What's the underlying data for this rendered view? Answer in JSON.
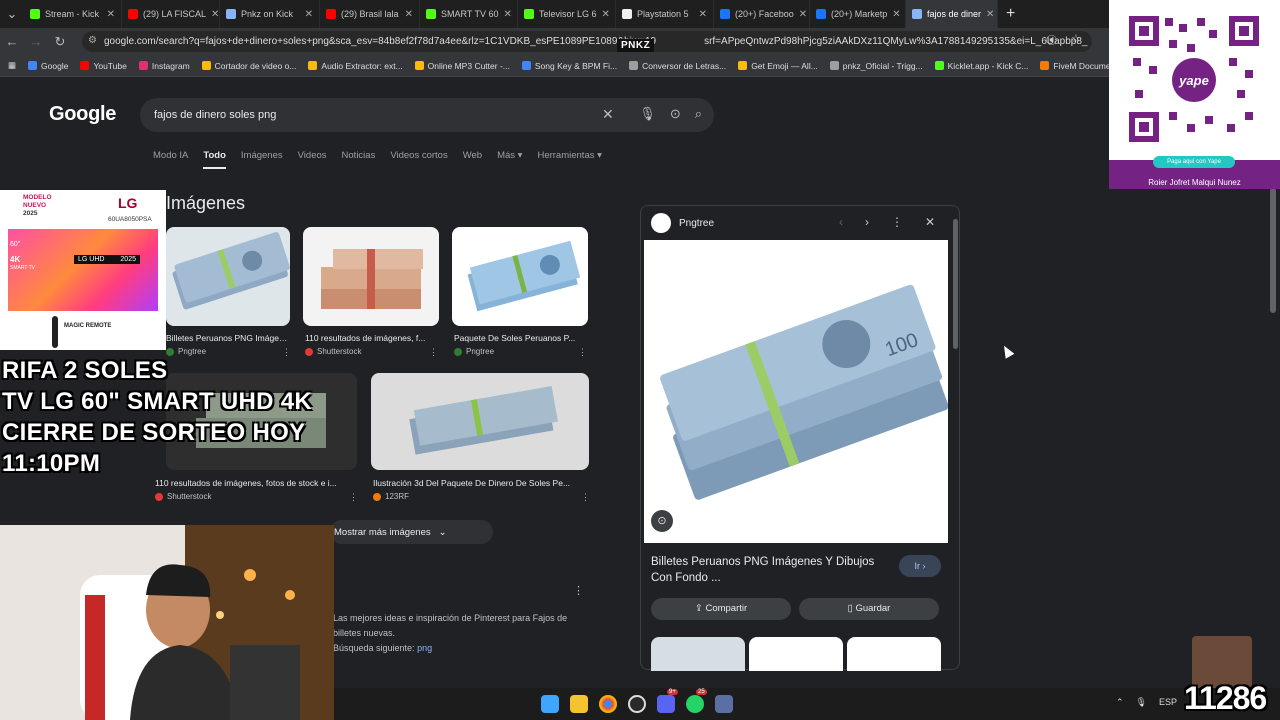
{
  "tabs": [
    {
      "label": "Stream - Kick",
      "color": "#53fc18"
    },
    {
      "label": "(29) LA FISCAL",
      "color": "#ff0000"
    },
    {
      "label": "Pnkz on Kick",
      "color": "#8ab4f8"
    },
    {
      "label": "(29) Brasil lala",
      "color": "#ff0000"
    },
    {
      "label": "SMART TV 60",
      "color": "#53fc18"
    },
    {
      "label": "Televisor LG 6",
      "color": "#53fc18"
    },
    {
      "label": "Playstation 5",
      "color": "#eeeeee"
    },
    {
      "label": "(20+) Faceboo",
      "color": "#1877f2"
    },
    {
      "label": "(20+) Marketp",
      "color": "#1877f2"
    },
    {
      "label": "fajos de diner",
      "color": "#8ab4f8",
      "active": true
    }
  ],
  "new_tab": "+",
  "tab_close": "✕",
  "address": "google.com/search?q=fajos+de+dinero+soles+png&sca_esv=84b8ef2f78d7a4ee&rlz=1C1VDKB_esPE1089PE1089&biw=19",
  "address_tail": "srf=APpeQntwzPd98hPjcg5ziAAkDXz11QMyLw%3A1788149295135&ei=L_6Uapbp8_",
  "overlay_tag": "PNKZ",
  "bookmarks": [
    {
      "label": "Google",
      "color": "#4285f4"
    },
    {
      "label": "YouTube",
      "color": "#ff0000"
    },
    {
      "label": "Instagram",
      "color": "#e1306c"
    },
    {
      "label": "Cortador de video o...",
      "color": "#fbbc05"
    },
    {
      "label": "Audio Extractor: ext...",
      "color": "#fbbc05"
    },
    {
      "label": "Online MP3 Cutter -...",
      "color": "#fbbc05"
    },
    {
      "label": "Song Key & BPM Fi...",
      "color": "#4285f4"
    },
    {
      "label": "Conversor de Letras...",
      "color": "#9e9e9e"
    },
    {
      "label": "Get Emoji — All...",
      "color": "#fbbc05"
    },
    {
      "label": "pnkz_Oficial - Trigg...",
      "color": "#9e9e9e"
    },
    {
      "label": "Kicklet.app - Kick C...",
      "color": "#53fc18"
    },
    {
      "label": "FiveM Documentat",
      "color": "#f57c00"
    }
  ],
  "google": {
    "logo": "Google",
    "query": "fajos de dinero soles png",
    "filters": [
      "Modo IA",
      "Todo",
      "Imágenes",
      "Videos",
      "Noticias",
      "Videos cortos",
      "Web",
      "Más ▾",
      "Herramientas ▾"
    ],
    "active_filter": "Todo",
    "section_title": "Imágenes",
    "results": [
      {
        "caption": "Billetes Peruanos PNG Imágenes...",
        "source": "Pngtree",
        "source_color": "#2e7d32"
      },
      {
        "caption": "110 resultados de imágenes, f...",
        "source": "Shutterstock",
        "source_color": "#e53935"
      },
      {
        "caption": "Paquete De Soles Peruanos P...",
        "source": "Pngtree",
        "source_color": "#2e7d32"
      },
      {
        "caption": "110 resultados de imágenes, fotos de stock e i...",
        "source": "Shutterstock",
        "source_color": "#e53935"
      },
      {
        "caption": "Ilustración 3d Del Paquete De Dinero De Soles Pe...",
        "source": "123RF",
        "source_color": "#f57c00"
      }
    ],
    "more_images": "Mostrar más imágenes",
    "pinterest_text": "Las mejores ideas e inspiración de Pinterest para Fajos de billetes nuevas.",
    "pinterest_prefix": "Búsqueda siguiente: ",
    "pinterest_link": "png"
  },
  "panel": {
    "source": "Pngtree",
    "title": "Billetes Peruanos PNG Imágenes Y Dibujos Con Fondo ...",
    "go_button": "Ir ›",
    "share_button": "Compartir",
    "save_button": "Guardar"
  },
  "promo": {
    "model_line1": "MODELO",
    "model_line2": "NUEVO",
    "model_year": "2025",
    "brand": "LG",
    "model_code": "60UA8050PSA",
    "tv_label": "LG UHD",
    "tv_year": "2025",
    "size": "60\"",
    "res": "4K",
    "smart": "SMART TV",
    "remote": "MAGIC REMOTE",
    "overlay_text": "RIFA 2 SOLES\nTV LG 60\" SMART UHD 4K\nCIERRE DE SORTEO HOY\n11:10PM"
  },
  "qr": {
    "pay_label": "Paga aquí con Yape",
    "name": "Roier Jofret Malqui Nunez",
    "brand": "yape"
  },
  "taskbar": {
    "lang": "ESP",
    "badge1": "9+",
    "badge2": "25"
  },
  "counter": "11286"
}
